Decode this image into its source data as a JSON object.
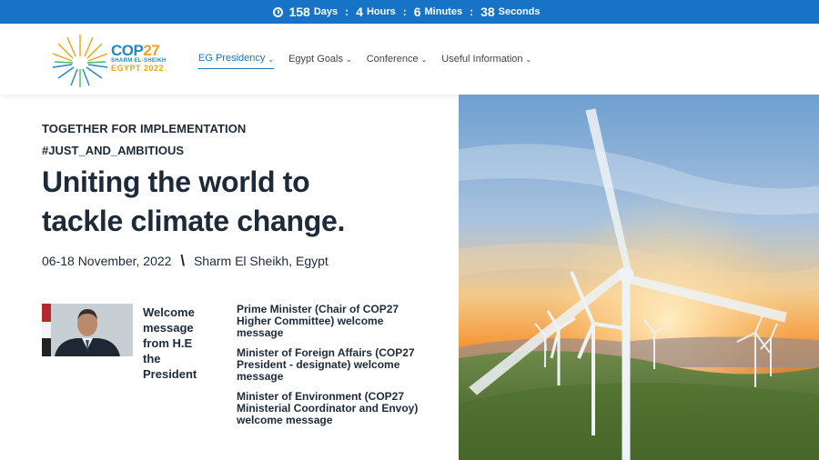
{
  "countdown": {
    "days": "158",
    "days_label": "Days",
    "hours": "4",
    "hours_label": "Hours",
    "minutes": "6",
    "minutes_label": "Minutes",
    "seconds": "38",
    "seconds_label": "Seconds",
    "separator": ":",
    "icon": "clock-icon"
  },
  "logo": {
    "cop": "COP",
    "num": "27",
    "sub1": "SHARM EL-SHEIKH",
    "sub2": "EGYPT 2022"
  },
  "nav": {
    "items": [
      {
        "label": "EG Presidency",
        "active": true
      },
      {
        "label": "Egypt Goals",
        "active": false
      },
      {
        "label": "Conference",
        "active": false
      },
      {
        "label": "Useful Information",
        "active": false
      }
    ],
    "chevron": "⌄"
  },
  "hero": {
    "tagline": "TOGETHER FOR IMPLEMENTATION",
    "hashtag": "#JUST_AND_AMBITIOUS",
    "headline_line1": "Uniting the world to",
    "headline_line2": "tackle climate change.",
    "dates": "06-18 November, 2022",
    "divider": "\\",
    "location": "Sharm El Sheikh, Egypt"
  },
  "welcome": {
    "president": "Welcome message from H.E the President",
    "messages": [
      "Prime Minister (Chair of COP27 Higher Committee) welcome message",
      "Minister of Foreign Affairs (COP27 President - designate) welcome message",
      "Minister of Environment (COP27 Ministerial Coordinator and Envoy) welcome message"
    ]
  },
  "colors": {
    "top_bar": "#1673c6",
    "heading": "#1c2a3a",
    "nav_active": "#1673c6",
    "logo_blue": "#1e88c8",
    "logo_gold": "#e3a417"
  }
}
